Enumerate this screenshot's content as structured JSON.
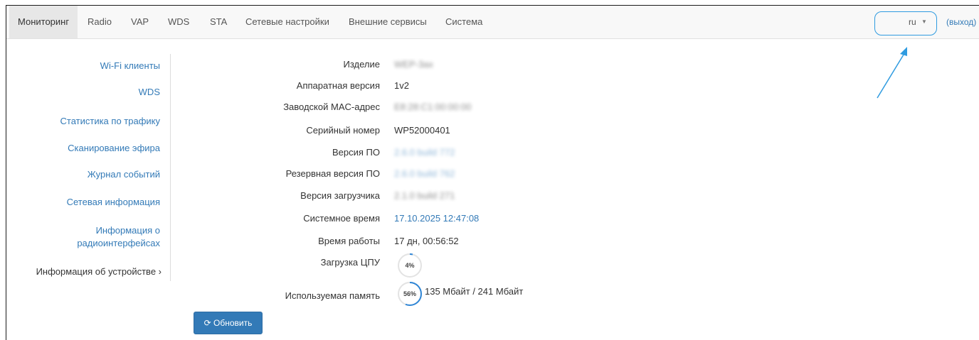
{
  "nav": {
    "tabs": [
      {
        "label": "Мониторинг"
      },
      {
        "label": "Radio"
      },
      {
        "label": "VAP"
      },
      {
        "label": "WDS"
      },
      {
        "label": "STA"
      },
      {
        "label": "Сетевые настройки"
      },
      {
        "label": "Внешние сервисы"
      },
      {
        "label": "Система"
      }
    ],
    "language": "ru",
    "logout": "(выход)"
  },
  "sidebar": {
    "items": [
      {
        "label": "Wi-Fi клиенты"
      },
      {
        "label": "WDS"
      },
      {
        "label": "Статистика по трафику"
      },
      {
        "label": "Сканирование эфира"
      },
      {
        "label": "Журнал событий"
      },
      {
        "label": "Сетевая информация"
      },
      {
        "label": "Информация о радиоинтерфейсах"
      },
      {
        "label": "Информация об устройстве ›"
      }
    ]
  },
  "device_info": {
    "product_label": "Изделие",
    "product_value": "WEP-3ax",
    "hw_label": "Аппаратная версия",
    "hw_value": "1v2",
    "mac_label": "Заводской MAC-адрес",
    "mac_value": "E8:28:C1:00:00:00",
    "serial_label": "Серийный номер",
    "serial_value": "WP52000401",
    "fw_label": "Версия ПО",
    "fw_value": "2.6.0 build 772",
    "fw_backup_label": "Резервная версия ПО",
    "fw_backup_value": "2.6.0 build 762",
    "boot_label": "Версия загрузчика",
    "boot_value": "2.1.0 build 271",
    "time_label": "Системное время",
    "time_value": "17.10.2025 12:47:08",
    "uptime_label": "Время работы",
    "uptime_value": "17 дн, 00:56:52",
    "cpu_label": "Загрузка ЦПУ",
    "cpu_value": "4%",
    "cpu_fraction": 0.04,
    "mem_label": "Используемая память",
    "mem_percent": "56%",
    "mem_fraction": 0.56,
    "mem_value": "135 Мбайт / 241 Мбайт"
  },
  "actions": {
    "refresh_label": "Обновить",
    "refresh_icon": "refresh-icon"
  },
  "colors": {
    "accent": "#337ab7",
    "annotation": "#2f9be0"
  }
}
